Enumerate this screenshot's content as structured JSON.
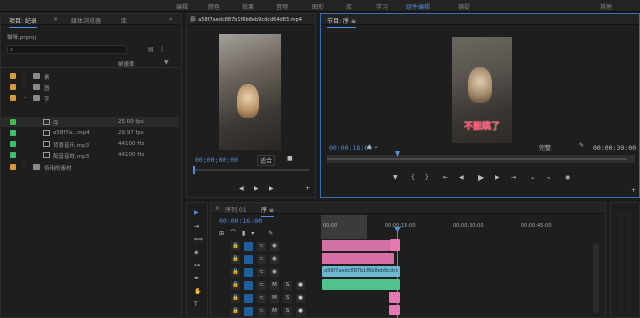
{
  "workspace": {
    "items": [
      "编辑",
      "颜色",
      "效果",
      "音频",
      "图形",
      "库",
      "学习",
      "组件编辑",
      "捕捉",
      "其他"
    ],
    "active": "组件编辑"
  },
  "project": {
    "tabs": [
      "项目: 纪录",
      "×",
      "媒体浏览器",
      "库"
    ],
    "path_label": "猫咪.prproj",
    "column_header": "帧速率",
    "search_placeholder": "",
    "rows": [
      {
        "color": "#d89a3d",
        "icon": "folder-icon",
        "name": "素",
        "rate": ""
      },
      {
        "color": "#d89a3d",
        "icon": "folder-icon",
        "name": "图",
        "rate": ""
      },
      {
        "color": "#d89a3d",
        "icon": "folder-icon",
        "name": "字",
        "rate": ""
      },
      {
        "color": "#41b94c",
        "icon": "sequence-icon",
        "name": "序",
        "rate": "25.00 fps"
      },
      {
        "color": "#3ec06a",
        "icon": "clip-icon",
        "name": "a58f7a...mp4",
        "rate": "29.97 fps"
      },
      {
        "color": "#3ec06a",
        "icon": "clip-icon",
        "name": "背景音乐.mp3",
        "rate": "44100 Hz"
      },
      {
        "color": "#3ec06a",
        "icon": "clip-icon",
        "name": "配音音效.mp3",
        "rate": "44100 Hz"
      },
      {
        "color": "#d89a3d",
        "icon": "folder-icon",
        "name": "待用的素材",
        "rate": ""
      }
    ]
  },
  "source": {
    "tab": "源: a58f7aedc887b1f6b8eb9cdcd64d83.mp4",
    "timecode": "00;00;00;00",
    "scale": "适合"
  },
  "program": {
    "tab": "节目: 序 ≡",
    "timecode": "00:00:18:00",
    "duration": "00:00:39:00",
    "fit": "完整",
    "caption": "不能跳了"
  },
  "timeline": {
    "tabs": [
      "×",
      "序列 01",
      "序 ≡"
    ],
    "timecode": "00:00:16:00",
    "ruler_labels": [
      "00:00",
      "00:00:15:00",
      "00:00:30:00",
      "00:00:45:00"
    ],
    "tracks": [
      {
        "id": "V3",
        "name": ""
      },
      {
        "id": "V2",
        "name": ""
      },
      {
        "id": "V1",
        "name": ""
      },
      {
        "id": "A1",
        "name": ""
      },
      {
        "id": "A2",
        "name": ""
      },
      {
        "id": "A3",
        "name": ""
      }
    ],
    "clip_label": "a58f7aedc887b1f6b8eb9cdcd64d83.mp4 [V]"
  },
  "colors": {
    "accent": "#4f8ee0",
    "video_clip": "#e57ab3",
    "audio_clip": "#4fc28e",
    "clip_blue": "#6fb6cf"
  }
}
